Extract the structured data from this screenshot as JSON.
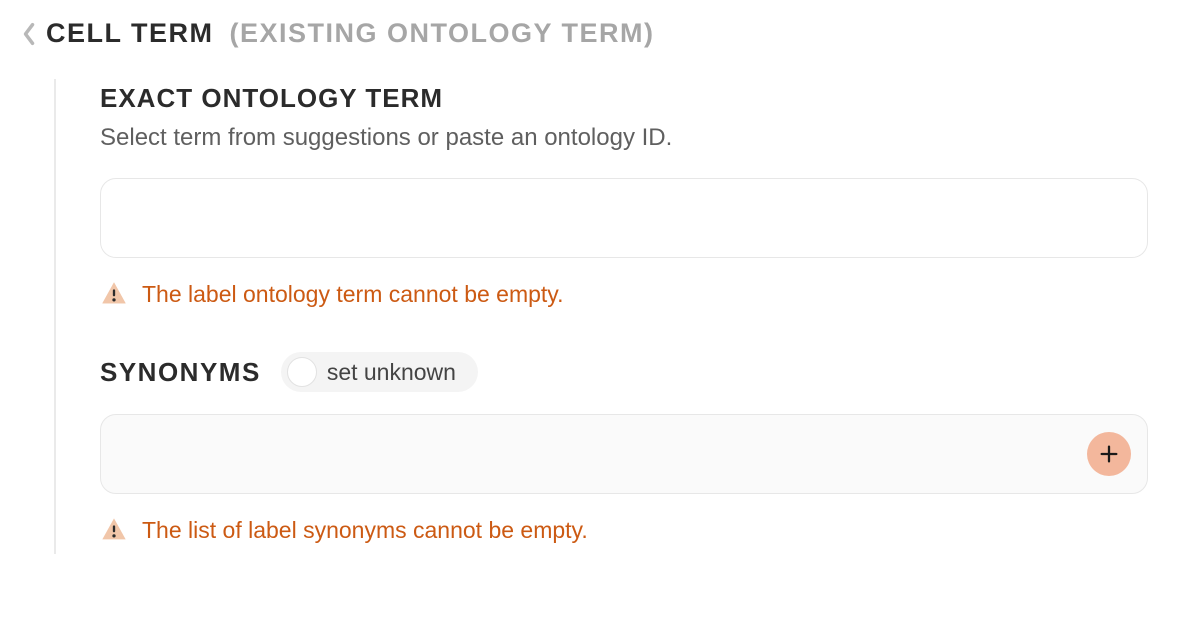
{
  "header": {
    "title": "CELL TERM",
    "subtitle": "(EXISTING ONTOLOGY TERM)"
  },
  "ontology": {
    "heading": "EXACT ONTOLOGY TERM",
    "description": "Select term from suggestions or paste an ontology ID.",
    "value": "",
    "warning": "The label ontology term cannot be empty."
  },
  "synonyms": {
    "heading": "SYNONYMS",
    "toggle_label": "set unknown",
    "value": "",
    "warning": "The list of label synonyms cannot be empty."
  }
}
